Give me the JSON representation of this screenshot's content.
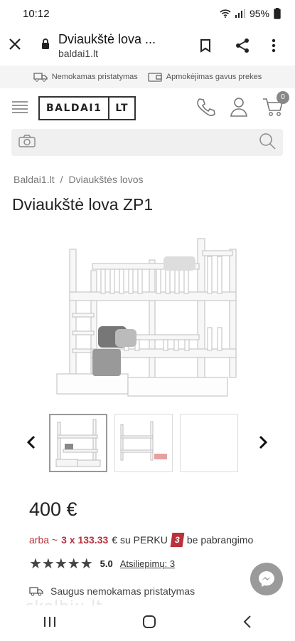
{
  "status": {
    "time": "10:12",
    "battery": "95%"
  },
  "browser": {
    "title": "Dviaukštė lova ...",
    "host": "baldai1.lt"
  },
  "infobar": {
    "free_delivery": "Nemokamas pristatymas",
    "pay_on_receipt": "Apmokėjimas gavus prekes"
  },
  "header": {
    "logo_main": "BALDAI1",
    "logo_suffix": "LT",
    "cart_count": "0"
  },
  "search": {
    "placeholder": ""
  },
  "breadcrumb": {
    "home": "Baldai1.lt",
    "sep": "/",
    "category": "Dviaukštės lovos"
  },
  "product": {
    "title": "Dviaukštė lova ZP1",
    "price": "400 €",
    "installment_prefix": "arba ~",
    "installment_amount": "3 x 133.33",
    "installment_middle": "€ su PERKU",
    "installment_badge": "3",
    "installment_suffix": "be pabrangimo",
    "rating_value": "5.0",
    "reviews_link": "Atsiliepimų: 3",
    "stars": 5,
    "shipping": "Saugus nemokamas pristatymas"
  },
  "watermark": "skelbiu.lt",
  "colors": {
    "accent_red": "#b8323b",
    "badge_gray": "#888888"
  }
}
